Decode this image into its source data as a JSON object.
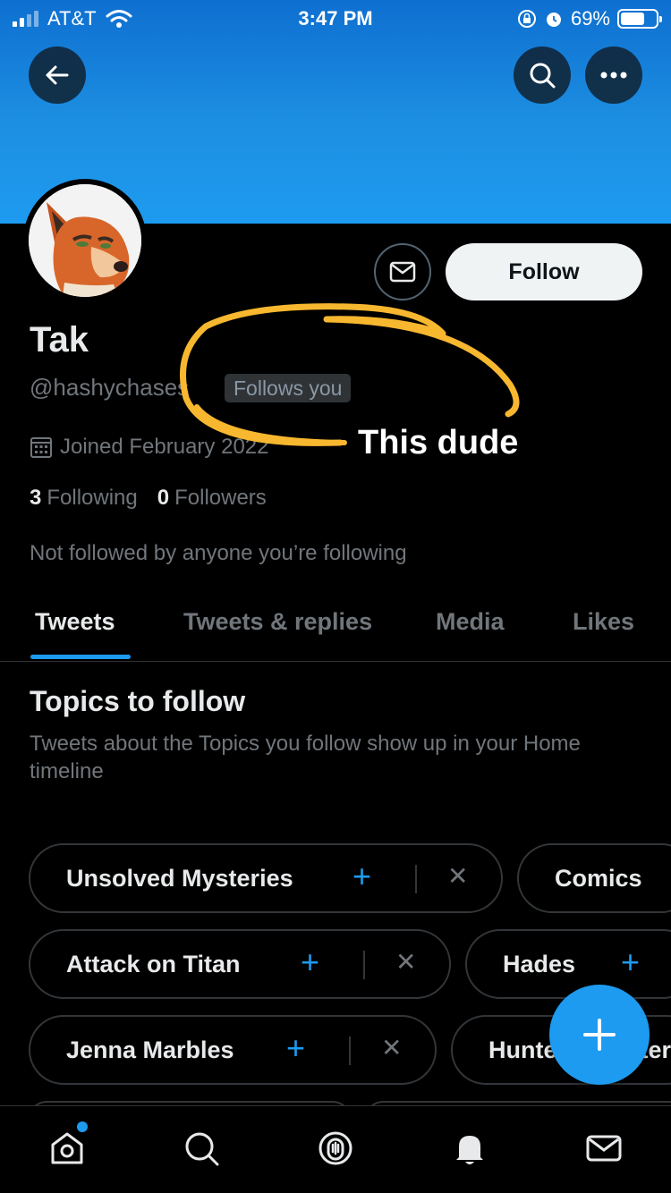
{
  "status_bar": {
    "carrier": "AT&T",
    "time": "3:47 PM",
    "battery": "69%",
    "battery_level": 0.69
  },
  "header": {
    "back_icon": "arrow-left-icon",
    "search_icon": "search-icon",
    "more_icon": "more-horizontal-icon"
  },
  "profile": {
    "name": "Tak",
    "handle": "@hashychases",
    "follows_you": "Follows you",
    "joined": "Joined February 2022",
    "following_count": "3",
    "following_label": "Following",
    "followers_count": "0",
    "followers_label": "Followers",
    "not_followed": "Not followed by anyone you’re following",
    "follow_button": "Follow"
  },
  "annotation": {
    "text": "This dude",
    "color": "#f7b72f"
  },
  "tabs": [
    {
      "label": "Tweets",
      "active": true
    },
    {
      "label": "Tweets & replies",
      "active": false
    },
    {
      "label": "Media",
      "active": false
    },
    {
      "label": "Likes",
      "active": false
    }
  ],
  "topics": {
    "title": "Topics to follow",
    "subtitle": "Tweets about the Topics you follow show up in your Home timeline",
    "chips": [
      {
        "label": "Unsolved Mysteries"
      },
      {
        "label": "Comics"
      },
      {
        "label": "Attack on Titan"
      },
      {
        "label": "Hades"
      },
      {
        "label": "Jenna Marbles"
      },
      {
        "label": "Hunter x Hunter"
      }
    ]
  },
  "bottom_nav": [
    {
      "icon": "home-icon"
    },
    {
      "icon": "search-icon"
    },
    {
      "icon": "spaces-icon"
    },
    {
      "icon": "notifications-icon"
    },
    {
      "icon": "messages-icon"
    }
  ],
  "colors": {
    "accent": "#1d9bf0",
    "banner": "#1d9bf0",
    "annotation": "#f7b72f"
  }
}
